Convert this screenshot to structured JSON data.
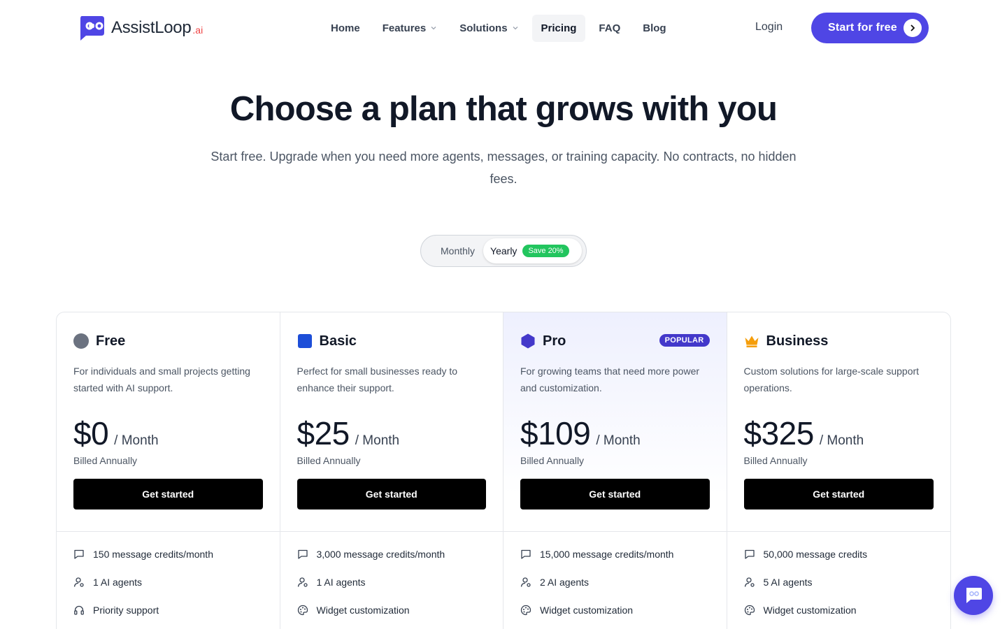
{
  "brand": {
    "name": "AssistLoop",
    "suffix": ".ai",
    "accent": "#4f46e5"
  },
  "nav": {
    "items": [
      {
        "label": "Home",
        "dropdown": false,
        "active": false
      },
      {
        "label": "Features",
        "dropdown": true,
        "active": false
      },
      {
        "label": "Solutions",
        "dropdown": true,
        "active": false
      },
      {
        "label": "Pricing",
        "dropdown": false,
        "active": true
      },
      {
        "label": "FAQ",
        "dropdown": false,
        "active": false
      },
      {
        "label": "Blog",
        "dropdown": false,
        "active": false
      }
    ],
    "login": "Login",
    "cta": "Start for free"
  },
  "hero": {
    "title": "Choose a plan that grows with you",
    "subtitle": "Start free. Upgrade when you need more agents, messages, or training capacity. No contracts, no hidden fees."
  },
  "billing_toggle": {
    "monthly": "Monthly",
    "yearly": "Yearly",
    "selected": "Yearly",
    "save_badge": "Save 20%"
  },
  "plans": [
    {
      "name": "Free",
      "icon": "circle-icon",
      "icon_color": "#6b7280",
      "description": "For individuals and small projects getting started with AI support.",
      "price": "$0",
      "period": "/ Month",
      "billed": "Billed Annually",
      "button": "Get started",
      "popular": false,
      "features": [
        {
          "icon": "message-icon",
          "text": "150 message credits/month"
        },
        {
          "icon": "agent-icon",
          "text": "1 AI agents"
        },
        {
          "icon": "headset-icon",
          "text": "Priority support"
        }
      ]
    },
    {
      "name": "Basic",
      "icon": "square-icon",
      "icon_color": "#1d4ed8",
      "description": "Perfect for small businesses ready to enhance their support.",
      "price": "$25",
      "period": "/ Month",
      "billed": "Billed Annually",
      "button": "Get started",
      "popular": false,
      "features": [
        {
          "icon": "message-icon",
          "text": "3,000 message credits/month"
        },
        {
          "icon": "agent-icon",
          "text": "1 AI agents"
        },
        {
          "icon": "palette-icon",
          "text": "Widget customization"
        }
      ]
    },
    {
      "name": "Pro",
      "icon": "hexagon-icon",
      "icon_color": "#4338ca",
      "description": "For growing teams that need more power and customization.",
      "price": "$109",
      "period": "/ Month",
      "billed": "Billed Annually",
      "button": "Get started",
      "popular": true,
      "badge": "POPULAR",
      "features": [
        {
          "icon": "message-icon",
          "text": "15,000 message credits/month"
        },
        {
          "icon": "agent-icon",
          "text": "2 AI agents"
        },
        {
          "icon": "palette-icon",
          "text": "Widget customization"
        }
      ]
    },
    {
      "name": "Business",
      "icon": "crown-icon",
      "icon_color": "#f59e0b",
      "description": "Custom solutions for large-scale support operations.",
      "price": "$325",
      "period": "/ Month",
      "billed": "Billed Annually",
      "button": "Get started",
      "popular": false,
      "features": [
        {
          "icon": "message-icon",
          "text": "50,000 message credits"
        },
        {
          "icon": "agent-icon",
          "text": "5 AI agents"
        },
        {
          "icon": "palette-icon",
          "text": "Widget customization"
        }
      ]
    }
  ]
}
